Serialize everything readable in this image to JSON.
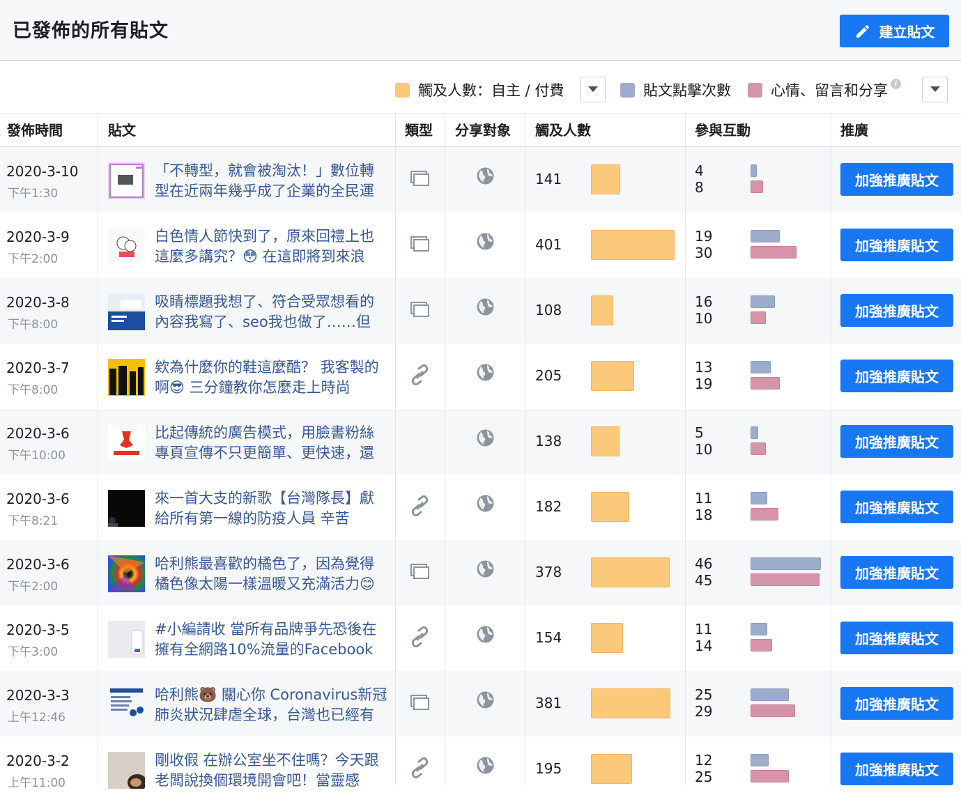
{
  "header": {
    "title": "已發佈的所有貼文",
    "create_label": "建立貼文"
  },
  "legend": {
    "reach": {
      "label": "觸及人數：自主 / 付費",
      "color": "#fcc97b"
    },
    "clicks": {
      "label": "貼文點擊次數",
      "color": "#9eaccc"
    },
    "engage": {
      "label": "心情、留言和分享",
      "color": "#d594a7"
    }
  },
  "columns": {
    "published": "發佈時間",
    "post": "貼文",
    "type": "類型",
    "targeting": "分享對象",
    "reach": "觸及人數",
    "engagement": "參與互動",
    "promote": "推廣"
  },
  "boost_label": "加強推廣貼文",
  "posts": [
    {
      "date": "2020-3-10",
      "time": "下午1:30",
      "text": "「不轉型，就會被淘汰！」數位轉型在近兩年幾乎成了企業的全民運",
      "type": "album",
      "reach": 141,
      "clicks": 4,
      "reactions": 8,
      "thumb": "t1"
    },
    {
      "date": "2020-3-9",
      "time": "下午2:00",
      "text": "白色情人節快到了，原來回禮上也這麼多講究？😳 在這即將到來浪",
      "type": "album",
      "reach": 401,
      "clicks": 19,
      "reactions": 30,
      "thumb": "t2"
    },
    {
      "date": "2020-3-8",
      "time": "下午8:00",
      "text": "吸睛標題我想了、符合受眾想看的內容我寫了、seo我也做了……但",
      "type": "album",
      "reach": 108,
      "clicks": 16,
      "reactions": 10,
      "thumb": "t3"
    },
    {
      "date": "2020-3-7",
      "time": "下午8:00",
      "text": "欸為什麼你的鞋這麼酷？ 我客製的啊😎 三分鐘教你怎麼走上時尚",
      "type": "link",
      "reach": 205,
      "clicks": 13,
      "reactions": 19,
      "thumb": "t4"
    },
    {
      "date": "2020-3-6",
      "time": "下午10:00",
      "text": "比起傳統的廣告模式，用臉書粉絲專頁宣傳不只更簡單、更快速，還",
      "type": "none",
      "reach": 138,
      "clicks": 5,
      "reactions": 10,
      "thumb": "t5"
    },
    {
      "date": "2020-3-6",
      "time": "下午8:21",
      "text": "來一首大支的新歌【台灣隊長】獻給所有第一線的防疫人員 辛苦",
      "type": "link",
      "reach": 182,
      "clicks": 11,
      "reactions": 18,
      "thumb": "t6"
    },
    {
      "date": "2020-3-6",
      "time": "下午2:00",
      "text": "哈利熊最喜歡的橘色了，因為覺得橘色像太陽一樣溫暖又充滿活力😊",
      "type": "album",
      "reach": 378,
      "clicks": 46,
      "reactions": 45,
      "thumb": "t7"
    },
    {
      "date": "2020-3-5",
      "time": "下午3:00",
      "text": "#小編請收 當所有品牌爭先恐後在擁有全網路10%流量的Facebook",
      "type": "link",
      "reach": 154,
      "clicks": 11,
      "reactions": 14,
      "thumb": "t8"
    },
    {
      "date": "2020-3-3",
      "time": "上午12:46",
      "text": "哈利熊🐻 關心你 Coronavirus新冠肺炎狀況肆虐全球，台灣也已經有",
      "type": "album",
      "reach": 381,
      "clicks": 25,
      "reactions": 29,
      "thumb": "t9"
    },
    {
      "date": "2020-3-2",
      "time": "上午11:00",
      "text": "剛收假 在辦公室坐不住嗎？今天跟老闆說換個環境開會吧！當靈感",
      "type": "link",
      "reach": 195,
      "clicks": 12,
      "reactions": 25,
      "thumb": "t10"
    }
  ]
}
